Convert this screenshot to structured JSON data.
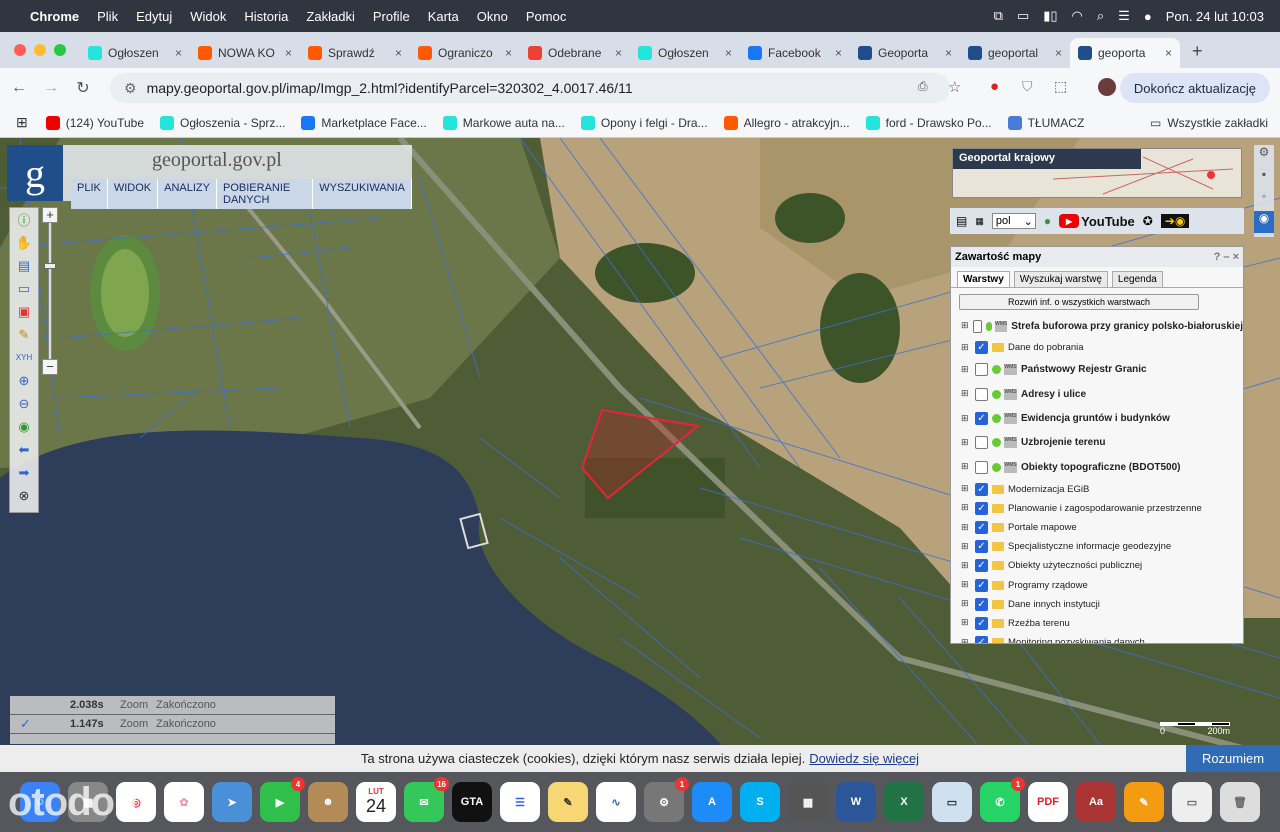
{
  "menubar": {
    "app": "Chrome",
    "items": [
      "Plik",
      "Edytuj",
      "Widok",
      "Historia",
      "Zakładki",
      "Profile",
      "Karta",
      "Okno",
      "Pomoc"
    ],
    "datetime": "Pon. 24 lut  10:03"
  },
  "tabs": [
    {
      "label": "Ogłoszen",
      "icon": "olx-icon",
      "color": "#23e5db"
    },
    {
      "label": "NOWA KO",
      "icon": "allegro-icon",
      "color": "#ff5a00"
    },
    {
      "label": "Sprawdź",
      "icon": "allegro-icon",
      "color": "#ff5a00"
    },
    {
      "label": "Ograniczo",
      "icon": "allegro-icon",
      "color": "#ff5a00"
    },
    {
      "label": "Odebrane",
      "icon": "gmail-icon",
      "color": "#ea4335"
    },
    {
      "label": "Ogłoszen",
      "icon": "olx-icon",
      "color": "#23e5db"
    },
    {
      "label": "Facebook",
      "icon": "facebook-icon",
      "color": "#1877f2"
    },
    {
      "label": "Geoporta",
      "icon": "geoportal-icon",
      "color": "#1f4e8a"
    },
    {
      "label": "geoportal",
      "icon": "geoportal-icon",
      "color": "#1f4e8a"
    },
    {
      "label": "geoporta",
      "icon": "geoportal-icon",
      "color": "#1f4e8a",
      "active": true
    }
  ],
  "address": {
    "url": "mapy.geoportal.gov.pl/imap/Imgp_2.html?identifyParcel=320302_4.0017.46/11",
    "update_button": "Dokończ aktualizację"
  },
  "bookmarks": [
    {
      "label": "(124) YouTube",
      "color": "#e00"
    },
    {
      "label": "Ogłoszenia - Sprz...",
      "color": "#23e5db"
    },
    {
      "label": "Marketplace Face...",
      "color": "#1877f2"
    },
    {
      "label": "Markowe auta na...",
      "color": "#23e5db"
    },
    {
      "label": "Opony i felgi - Dra...",
      "color": "#23e5db"
    },
    {
      "label": "Allegro - atrakcyjn...",
      "color": "#ff5a00"
    },
    {
      "label": "ford - Drawsko Po...",
      "color": "#23e5db"
    },
    {
      "label": "TŁUMACZ",
      "color": "#4a7bd8"
    }
  ],
  "bookmarks_all": "Wszystkie zakładki",
  "geoportal": {
    "title": "geoportal.gov.pl",
    "menu": [
      "PLIK",
      "WIDOK",
      "ANALIZY",
      "POBIERANIE DANYCH",
      "WYSZUKIWANIA"
    ],
    "minimap_title": "Geoportal krajowy",
    "language": "pol",
    "youtube_label": "YouTube"
  },
  "panel": {
    "title": "Zawartość mapy",
    "tabs": [
      "Warstwy",
      "Wyszukaj warstwę",
      "Legenda"
    ],
    "expand_button": "Rozwiń inf. o wszystkich warstwach",
    "layers": [
      {
        "label": "Strefa buforowa przy granicy polsko-białoruskiej",
        "checked": false,
        "bold": true,
        "type": "wms"
      },
      {
        "label": "Dane do pobrania",
        "checked": true,
        "bold": false,
        "type": "folder"
      },
      {
        "label": "Państwowy Rejestr Granic",
        "checked": false,
        "bold": true,
        "type": "wms"
      },
      {
        "label": "Adresy i ulice",
        "checked": false,
        "bold": true,
        "type": "wms"
      },
      {
        "label": "Ewidencja gruntów i budynków",
        "checked": true,
        "bold": true,
        "type": "wms"
      },
      {
        "label": "Uzbrojenie terenu",
        "checked": false,
        "bold": true,
        "type": "wms"
      },
      {
        "label": "Obiekty topograficzne (BDOT500)",
        "checked": false,
        "bold": true,
        "type": "wms"
      },
      {
        "label": "Modernizacja EGiB",
        "checked": true,
        "bold": false,
        "type": "folder"
      },
      {
        "label": "Planowanie i zagospodarowanie przestrzenne",
        "checked": true,
        "bold": false,
        "type": "folder"
      },
      {
        "label": "Portale mapowe",
        "checked": true,
        "bold": false,
        "type": "folder"
      },
      {
        "label": "Specjalistyczne informacje geodezyjne",
        "checked": true,
        "bold": false,
        "type": "folder"
      },
      {
        "label": "Obiekty użyteczności publicznej",
        "checked": true,
        "bold": false,
        "type": "folder"
      },
      {
        "label": "Programy rządowe",
        "checked": true,
        "bold": false,
        "type": "folder"
      },
      {
        "label": "Dane innych instytucji",
        "checked": true,
        "bold": false,
        "type": "folder"
      },
      {
        "label": "Rzeźba terenu",
        "checked": true,
        "bold": false,
        "type": "folder"
      },
      {
        "label": "Monitoring pozyskiwania danych",
        "checked": true,
        "bold": false,
        "type": "folder"
      }
    ]
  },
  "status_rows": [
    {
      "time": "2.038s",
      "action": "Zoom",
      "state": "Zakończono"
    },
    {
      "time": "1.147s",
      "action": "Zoom",
      "state": "Zakończono"
    }
  ],
  "scale": {
    "left": "0",
    "right": "200m"
  },
  "cookie": {
    "text": "Ta strona używa ciasteczek (cookies), dzięki którym nasz serwis działa lepiej.",
    "link": "Dowiedz się więcej",
    "button": "Rozumiem"
  },
  "dock": {
    "calendar_month": "LUT",
    "calendar_day": "24",
    "badges": {
      "facetime": "4",
      "messages": "16",
      "settings": "1",
      "whatsapp": "1"
    }
  },
  "watermark": "otodom"
}
